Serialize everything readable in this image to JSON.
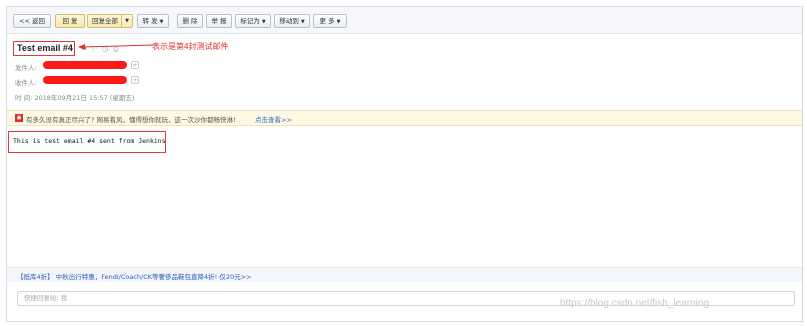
{
  "toolbar": {
    "back": "<< 返回",
    "reply": "回 复",
    "reply_all": "回复全部",
    "forward": "转 发",
    "delete": "删 除",
    "report": "举 报",
    "mark_as": "标记为",
    "move_to": "移动到",
    "more": "更 多"
  },
  "mail": {
    "subject": "Test email #4",
    "annotation": "表示是第4封测试邮件",
    "from_label": "发件人:",
    "to_label": "收件人:",
    "time_label": "时  间:",
    "time_value": "2018年09月21日 15:57 (星期五)"
  },
  "notice": {
    "text": "有多久没有真正尽兴了? 网易看风，懂得想你就玩，这一次沙你都畅快淋!",
    "link": "点击查看>>"
  },
  "body": {
    "text": "This is test email #4 sent from Jenkins"
  },
  "ad": {
    "text": "【抵库4折】 中秋出行特惠，Fendi/Coach/CK等奢侈品鞋包直降4折! 仅20元>>"
  },
  "reply_box": {
    "placeholder": "快捷回复给: 我"
  },
  "watermark": "https://blog.csdn.net/fish_learning",
  "colors": {
    "annotation_red": "#e03030",
    "redaction": "#ff1a1a",
    "link_blue": "#2a6fc9"
  }
}
